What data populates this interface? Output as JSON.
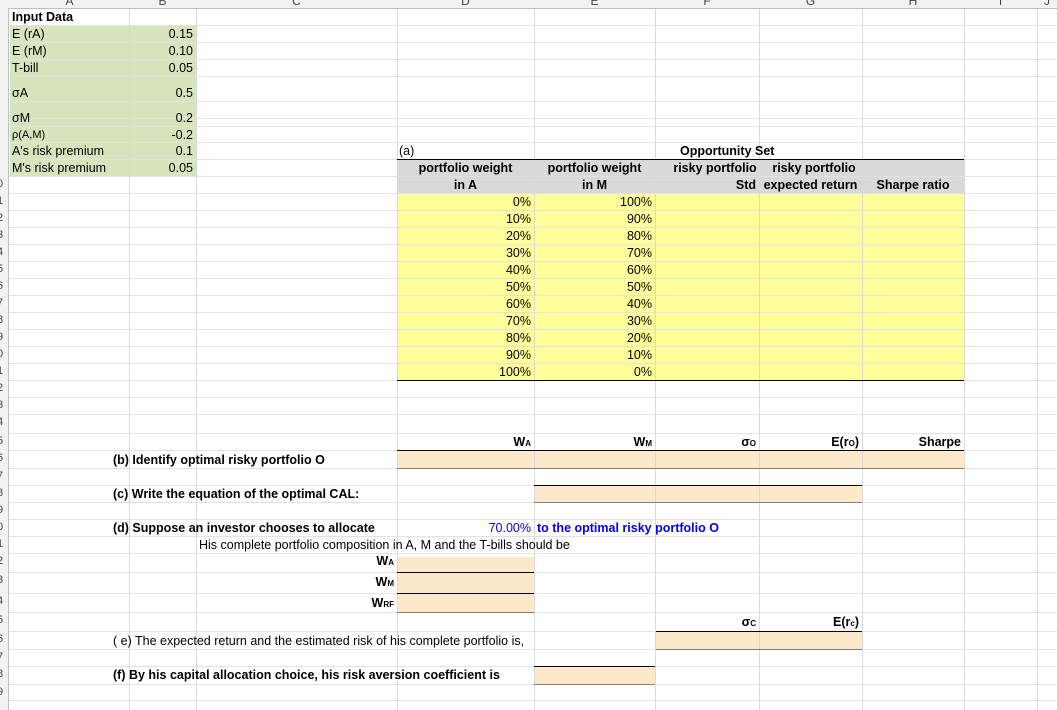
{
  "columns": [
    "A",
    "B",
    "C",
    "D",
    "E",
    "F",
    "G",
    "H",
    "I",
    "J"
  ],
  "row_numbers": [
    "0",
    "1",
    "2",
    "3",
    "4",
    "5",
    "6",
    "7",
    "8",
    "9",
    "0",
    "1",
    "2",
    "3",
    "4",
    "5",
    "6",
    "7",
    "8",
    "9",
    "0",
    "1",
    "2",
    "3",
    "4",
    "5",
    "6",
    "7",
    "8",
    "9"
  ],
  "input_data": {
    "title": "Input Data",
    "labels": {
      "ea": "E (rA)",
      "em": "E (rM)",
      "tbill": "T-bill",
      "sigma_a": "σA",
      "sigma_m": "σM",
      "rho": "ρ(A,M)",
      "a_prem": "A's risk premium",
      "m_prem": "M's risk premium"
    },
    "values": {
      "ea": "0.15",
      "em": "0.10",
      "tbill": "0.05",
      "sigma_a": "0.5",
      "sigma_m": "0.2",
      "rho": "-0.2",
      "a_prem": "0.1",
      "m_prem": "0.05"
    }
  },
  "section_a": {
    "label": "(a)",
    "opportunity_set": "Opportunity  Set",
    "headers": {
      "wa_line1": "portfolio weight",
      "wa_line2": "in A",
      "wm_line1": "portfolio weight",
      "wm_line2": "in M",
      "std_line1": "risky portfolio",
      "std_line2": "Std",
      "er_line1": "risky portfolio",
      "er_line2": "expected return",
      "sharpe": "Sharpe ratio"
    },
    "weights_a": [
      "0%",
      "10%",
      "20%",
      "30%",
      "40%",
      "50%",
      "60%",
      "70%",
      "80%",
      "90%",
      "100%"
    ],
    "weights_m": [
      "100%",
      "90%",
      "80%",
      "70%",
      "60%",
      "50%",
      "40%",
      "30%",
      "20%",
      "10%",
      "0%"
    ]
  },
  "section_b": {
    "labels": {
      "wa": "W",
      "wa_sub": "A",
      "wm": "W",
      "wm_sub": "M",
      "so": "σ",
      "so_sub": "O",
      "ero": "E(r",
      "ero_sub": "O",
      "ero_end": ")",
      "sharpe": "Sharpe"
    },
    "prompt": "(b) Identify optimal risky portfolio O"
  },
  "section_c": {
    "prompt": "(c) Write the equation of the optimal CAL:"
  },
  "section_d": {
    "prompt": "(d) Suppose an investor chooses to allocate",
    "allocation": "70.00%",
    "suffix": "to the optimal risky portfolio O",
    "composition": "His complete portfolio composition in A, M and the T-bills should be",
    "w": "W",
    "wa_sub": "A",
    "wm_sub": "M",
    "wrf_sub": "RF"
  },
  "section_e": {
    "prompt": "( e) The expected return and the estimated risk of his complete portfolio is,",
    "sc": "σ",
    "sc_sub": "C",
    "erc": "E(r",
    "erc_sub": "c",
    "erc_end": ")"
  },
  "section_f": {
    "prompt": "(f) By his capital allocation choice, his risk aversion coefficient  is"
  },
  "colors": {
    "green": "#d8e4bc",
    "yellow": "#ffff99",
    "peach": "#fde9c9",
    "blue": "#0000ff",
    "header_gray": "#d9d9d9"
  }
}
